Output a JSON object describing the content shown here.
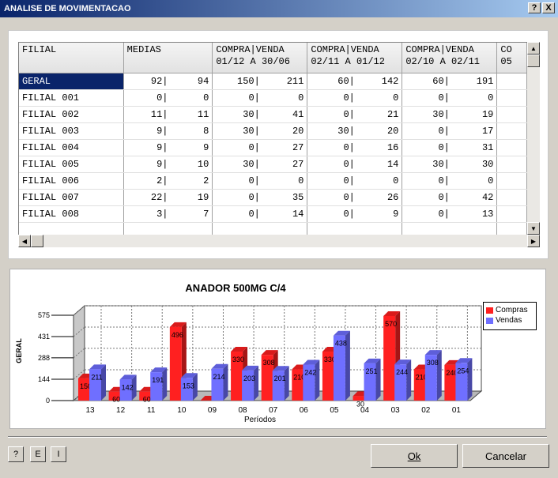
{
  "window": {
    "title": "ANALISE DE MOVIMENTACAO",
    "help_btn": "?",
    "close_btn": "X"
  },
  "grid": {
    "headers": [
      {
        "line1": "FILIAL",
        "line2": ""
      },
      {
        "line1": "MEDIAS",
        "line2": ""
      },
      {
        "line1": "COMPRA|VENDA",
        "line2": "01/12 A 30/06"
      },
      {
        "line1": "COMPRA|VENDA",
        "line2": "02/11 A 01/12"
      },
      {
        "line1": "COMPRA|VENDA",
        "line2": "02/10 A 02/11"
      },
      {
        "line1": "CO",
        "line2": "05"
      }
    ],
    "rows": [
      {
        "name": "GERAL",
        "vals": [
          [
            "92|",
            "94"
          ],
          [
            "150|",
            "211"
          ],
          [
            "60|",
            "142"
          ],
          [
            "60|",
            "191"
          ]
        ]
      },
      {
        "name": "FILIAL 001",
        "vals": [
          [
            "0|",
            "0"
          ],
          [
            "0|",
            "0"
          ],
          [
            "0|",
            "0"
          ],
          [
            "0|",
            "0"
          ]
        ]
      },
      {
        "name": "FILIAL 002",
        "vals": [
          [
            "11|",
            "11"
          ],
          [
            "30|",
            "41"
          ],
          [
            "0|",
            "21"
          ],
          [
            "30|",
            "19"
          ]
        ]
      },
      {
        "name": "FILIAL 003",
        "vals": [
          [
            "9|",
            "8"
          ],
          [
            "30|",
            "20"
          ],
          [
            "30|",
            "20"
          ],
          [
            "0|",
            "17"
          ]
        ]
      },
      {
        "name": "FILIAL 004",
        "vals": [
          [
            "9|",
            "9"
          ],
          [
            "0|",
            "27"
          ],
          [
            "0|",
            "16"
          ],
          [
            "0|",
            "31"
          ]
        ]
      },
      {
        "name": "FILIAL 005",
        "vals": [
          [
            "9|",
            "10"
          ],
          [
            "30|",
            "27"
          ],
          [
            "0|",
            "14"
          ],
          [
            "30|",
            "30"
          ]
        ]
      },
      {
        "name": "FILIAL 006",
        "vals": [
          [
            "2|",
            "2"
          ],
          [
            "0|",
            "0"
          ],
          [
            "0|",
            "0"
          ],
          [
            "0|",
            "0"
          ]
        ]
      },
      {
        "name": "FILIAL 007",
        "vals": [
          [
            "22|",
            "19"
          ],
          [
            "0|",
            "35"
          ],
          [
            "0|",
            "26"
          ],
          [
            "0|",
            "42"
          ]
        ]
      },
      {
        "name": "FILIAL 008",
        "vals": [
          [
            "3|",
            "7"
          ],
          [
            "0|",
            "14"
          ],
          [
            "0|",
            "9"
          ],
          [
            "0|",
            "13"
          ]
        ]
      }
    ]
  },
  "chart_data": {
    "type": "bar",
    "title": "ANADOR 500MG C/4",
    "xlabel": "Períodos",
    "ylabel": "GERAL",
    "categories": [
      "13",
      "12",
      "11",
      "10",
      "09",
      "08",
      "07",
      "06",
      "05",
      "04",
      "03",
      "02",
      "01"
    ],
    "series": [
      {
        "name": "Compras",
        "color": "#ff2020",
        "values": [
          150,
          60,
          60,
          496,
          0,
          330,
          308,
          210,
          330,
          30,
          570,
          210,
          240
        ]
      },
      {
        "name": "Vendas",
        "color": "#6f6fff",
        "values": [
          211,
          142,
          191,
          153,
          214,
          203,
          201,
          242,
          438,
          251,
          244,
          308,
          254
        ]
      }
    ],
    "yticks": [
      0,
      144,
      288,
      431,
      575
    ],
    "ylim": [
      0,
      575
    ],
    "grid": true,
    "legend": "right"
  },
  "buttons": {
    "help": "?",
    "e": "E",
    "i": "I",
    "ok": "Ok",
    "cancel": "Cancelar"
  }
}
